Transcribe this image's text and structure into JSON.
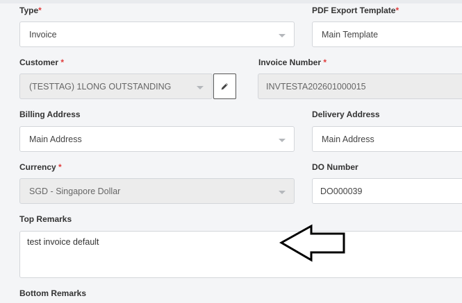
{
  "form": {
    "type": {
      "label": "Type",
      "required_mark": "*",
      "value": "Invoice"
    },
    "pdf_template": {
      "label": "PDF Export Template",
      "required_mark": "*",
      "value": "Main Template"
    },
    "customer": {
      "label": "Customer",
      "required_mark": "*",
      "value": "(TESTTAG) 1LONG OUTSTANDING"
    },
    "invoice_number": {
      "label": "Invoice Number",
      "required_mark": "*",
      "value": "INVTESTA202601000015"
    },
    "billing_address": {
      "label": "Billing Address",
      "value": "Main Address"
    },
    "delivery_address": {
      "label": "Delivery Address",
      "value": "Main Address"
    },
    "currency": {
      "label": "Currency",
      "required_mark": "*",
      "value": "SGD - Singapore Dollar"
    },
    "do_number": {
      "label": "DO Number",
      "value": "DO000039"
    },
    "top_remarks": {
      "label": "Top Remarks",
      "value": "test invoice default"
    },
    "bottom_remarks": {
      "label": "Bottom Remarks"
    }
  },
  "icons": {
    "edit": "pencil-icon",
    "dropdown": "chevron-down-icon",
    "annotation": "left-arrow-icon"
  },
  "colors": {
    "required": "#e03b3b",
    "border": "#d3d6da",
    "disabled_bg": "#ececec"
  }
}
